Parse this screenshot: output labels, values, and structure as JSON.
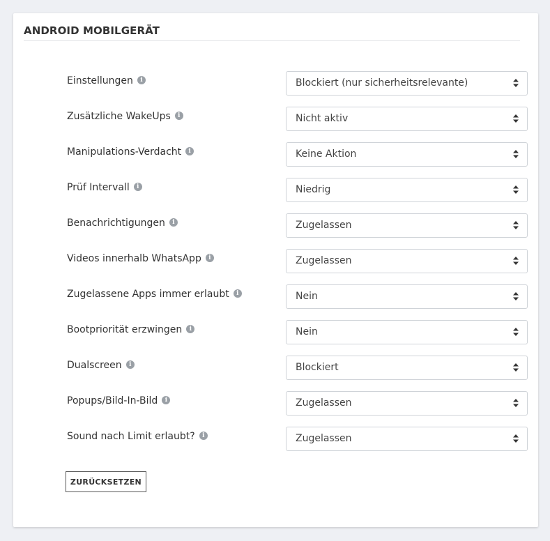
{
  "panel": {
    "title": "ANDROID MOBILGERÄT",
    "reset_label": "ZURÜCKSETZEN"
  },
  "settings": [
    {
      "label": "Einstellungen",
      "value": "Blockiert (nur sicherheitsrelevante)"
    },
    {
      "label": "Zusätzliche WakeUps",
      "value": "Nicht aktiv"
    },
    {
      "label": "Manipulations-Verdacht",
      "value": "Keine Aktion"
    },
    {
      "label": "Prüf Intervall",
      "value": "Niedrig"
    },
    {
      "label": "Benachrichtigungen",
      "value": "Zugelassen"
    },
    {
      "label": "Videos innerhalb WhatsApp",
      "value": "Zugelassen"
    },
    {
      "label": "Zugelassene Apps immer erlaubt",
      "value": "Nein"
    },
    {
      "label": "Bootpriorität erzwingen",
      "value": "Nein"
    },
    {
      "label": "Dualscreen",
      "value": "Blockiert"
    },
    {
      "label": "Popups/Bild-In-Bild",
      "value": "Zugelassen"
    },
    {
      "label": "Sound nach Limit erlaubt?",
      "value": "Zugelassen"
    }
  ],
  "icons": {
    "info": "info-icon",
    "select_arrows": "sort-arrows-icon"
  },
  "colors": {
    "background": "#eef0f4",
    "card": "#ffffff",
    "border": "#cfd3d8",
    "info_icon": "#9aa0a6"
  }
}
